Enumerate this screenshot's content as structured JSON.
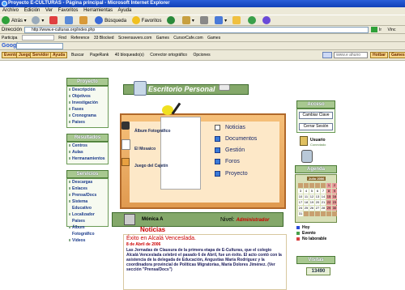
{
  "window": {
    "title": "Proyecto E-CULTURAS - Página principal - Microsoft Internet Explorer"
  },
  "menu": [
    "Archivo",
    "Edición",
    "Ver",
    "Favoritos",
    "Herramientas",
    "Ayuda"
  ],
  "nav": {
    "back": "Atrás",
    "search": "Búsqueda",
    "favorites": "Favoritos"
  },
  "address": {
    "label": "Dirección",
    "url": "http://www.e-culturas.org/index.php",
    "go": "Ir",
    "links": "Vínc"
  },
  "links": [
    "Participa",
    "Find",
    "Reference",
    "33 Blocked",
    "Screensavers.com",
    "Games",
    "CursorCafe.com",
    "Games"
  ],
  "google": {
    "logo": "Google"
  },
  "sitebar": {
    "buttons": [
      "Evento",
      "Juego",
      "Servidor",
      "Ayuda"
    ],
    "tools": [
      "Buscar",
      "PageRank",
      "40 bloqueado(s)",
      "Corrector ortográfico",
      "Opciones"
    ],
    "email_placeholder": "www.e ahuno",
    "extra_buttons": [
      "Hotbar",
      "Games"
    ]
  },
  "proyecto": {
    "title": "Proyecto",
    "items": [
      "Descripción",
      "Objetivos",
      "Investigación",
      "Fases",
      "Cronograma",
      "Países"
    ]
  },
  "resultados": {
    "title": "Resultados",
    "items": [
      "Centros",
      "Aulas",
      "Hermanamientos"
    ]
  },
  "servicios": {
    "title": "Servicios",
    "items": [
      "Descargas",
      "Enlaces",
      "Prensa/Docs",
      "Sistema Educativo",
      "Localizador Países",
      "Álbum Fotográfico",
      "Vídeos"
    ]
  },
  "desk": {
    "title": "Escritorio Personal",
    "left_links": [
      "Álbum Fotográfico",
      "El Mosaico",
      "Juego del Cajetín"
    ],
    "apps": [
      "Noticias",
      "Documentos",
      "Gestión",
      "Foros",
      "Proyecto"
    ]
  },
  "user": {
    "name": "Mónica A",
    "level_label": "Nivel:",
    "level": "Administrador"
  },
  "news": {
    "heading": "Noticias",
    "title": "Éxito en Alcalá Venceslada.",
    "date": "8 de Abril de 2006",
    "text": "Las Jornadas de Clausura de la primera etapa de E-Culturas, que el colegio Alcalá Venceslada celebró el pasado 6 de Abril, fue un éxito. El acto contó con la asistencia de la delegada de Educación, Angustias María Rodríguez y la coordinadora provincial de Políticas Migratorias, María Dolores Jiménez. (Ver sección \"Prensa/Docs\")"
  },
  "right": {
    "acceso": "Acceso",
    "cambiar_clave": "Cambiar Clave",
    "cerrar_sesion": "Cerrar Sesión",
    "usuario": "Usuario",
    "conectado": "Conectado",
    "agenda": "Agenda",
    "month": "Julio 2006",
    "days": [
      "1",
      "2",
      "3",
      "4",
      "5",
      "6",
      "7",
      "8",
      "9",
      "10",
      "11",
      "12",
      "13",
      "14",
      "15",
      "16",
      "17",
      "18",
      "19",
      "20",
      "21",
      "22",
      "23",
      "24",
      "25",
      "26",
      "27",
      "28",
      "29",
      "30",
      "31"
    ],
    "legend": [
      "Hoy",
      "Evento",
      "No laborable"
    ],
    "visitas": "Visitas",
    "counter": "13490"
  },
  "colors": {
    "accent": "#84a86a",
    "news": "#cc0000",
    "titlebar": "#1140b8"
  }
}
